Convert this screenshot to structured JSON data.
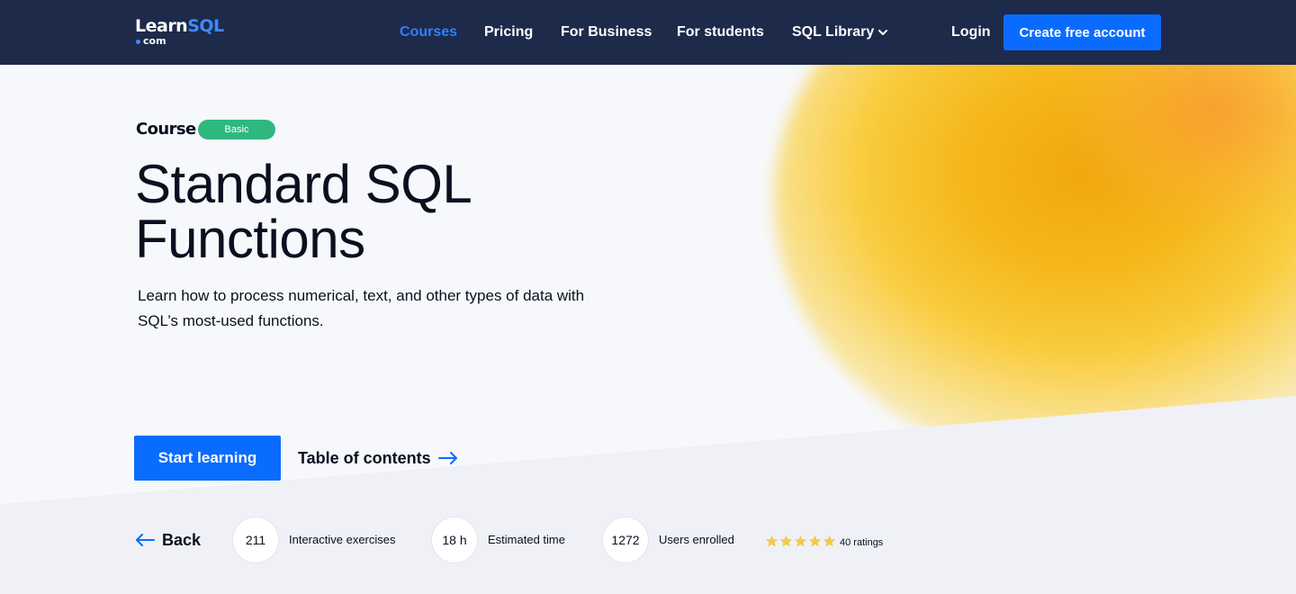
{
  "nav": {
    "logo_main": "Learn",
    "logo_accent": "SQL",
    "logo_sub": "com",
    "links": [
      "Courses",
      "Pricing",
      "For Business",
      "For students",
      "SQL Library"
    ],
    "login": "Login",
    "create_account": "Create free account",
    "active_color": "#2f80ff",
    "bg_color": "#1e2a4a"
  },
  "hero": {
    "eyebrow": "Course",
    "badge": "Basic",
    "badge_color": "#2fb780",
    "title_line1": "Standard SQL",
    "title_line2": "Functions",
    "description": "Learn how to process numerical, text, and other types of data with SQL’s most-used functions.",
    "start_button": "Start learning",
    "toc_link": "Table of contents",
    "accent_color": "#0a6cff"
  },
  "stats": {
    "back": "Back",
    "exercises_value": "211",
    "exercises_label": "Interactive exercises",
    "time_value": "18 h",
    "time_label": "Estimated time",
    "users_value": "1272",
    "users_label": "Users enrolled",
    "rating_stars": 5,
    "ratings_label": "40 ratings",
    "star_color": "#f5c84c"
  }
}
